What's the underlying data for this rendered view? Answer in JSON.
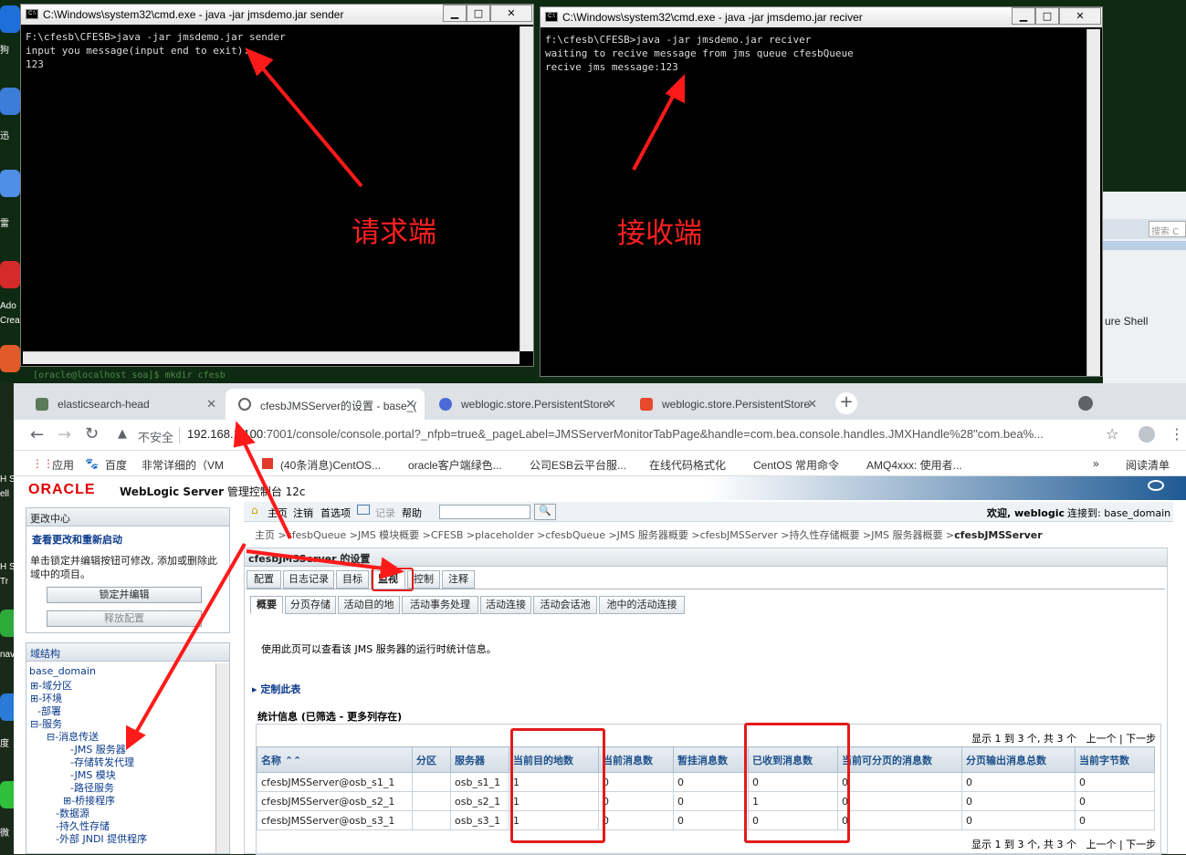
{
  "desktop": {
    "labels": [
      "狗",
      "迅",
      "雷",
      "Ado",
      "Crea",
      "H S",
      "ell",
      "H S",
      "Tr",
      "nav",
      "度",
      "微"
    ],
    "right_label": "ure Shell",
    "search_placeholder": "搜索 C",
    "faded_cmd": "[oracle@localhost soa]$ mkdir cfesb"
  },
  "sender": {
    "title": "C:\\Windows\\system32\\cmd.exe - java  -jar jmsdemo.jar sender",
    "lines": [
      "F:\\cfesb\\CFESB>java -jar jmsdemo.jar sender",
      "input you message(input end to exit):",
      "123"
    ],
    "annotation": "请求端"
  },
  "receiver": {
    "title": "C:\\Windows\\system32\\cmd.exe - java  -jar jmsdemo.jar reciver",
    "lines": [
      "f:\\cfesb\\CFESB>java -jar jmsdemo.jar reciver",
      "waiting to recive message from jms queue cfesbQueue",
      "recive jms message:123"
    ],
    "annotation": "接收端"
  },
  "window_buttons": {
    "min": "▁",
    "max": "□",
    "close": "✕"
  },
  "browser": {
    "tabs": [
      {
        "label": "elasticsearch-head",
        "color": "#5a7a5a"
      },
      {
        "label": "cfesbJMSServer的设置 - base_(",
        "color": "#888888"
      },
      {
        "label": "weblogic.store.PersistentStore",
        "color": "#4a6ad8"
      },
      {
        "label": "weblogic.store.PersistentStore",
        "color": "#e8482b"
      }
    ],
    "close": "✕",
    "new_tab": "+",
    "insecure": "不安全",
    "url_host": "192.168.1.100",
    "url_rest": ":7001/console/console.portal?_nfpb=true&_pageLabel=JMSServerMonitorTabPage&handle=com.bea.console.handles.JMXHandle%28\"com.bea%...",
    "bookmarks": [
      "应用",
      "百度",
      "非常详细的（VM",
      "(40条消息)CentOS...",
      "oracle客户端绿色...",
      "公司ESB云平台服...",
      "在线代码格式化",
      "CentOS 常用命令",
      "AMQ4xxx: 使用者...",
      "阅读清单"
    ],
    "bookmark_more": "»"
  },
  "weblogic": {
    "brand": "ORACLE",
    "product": "WebLogic Server",
    "product_suffix": "管理控制台 12c",
    "toolbar": [
      "主页",
      "注销",
      "首选项",
      "记录",
      "帮助"
    ],
    "welcome": "欢迎, weblogic",
    "connected": "连接到: base_domain",
    "breadcrumb": "主页 >cfesbQueue >JMS 模块概要 >CFESB >placeholder >cfesbQueue >JMS 服务器概要 >cfesbJMSServer >持久性存储概要 >JMS 服务器概要 >",
    "breadcrumb_last": "cfesbJMSServer",
    "change_center": {
      "title": "更改中心",
      "link": "查看更改和重新启动",
      "desc": "单击锁定并编辑按钮可修改, 添加或删除此域中的项目。",
      "lock_button": "锁定并编辑",
      "release_button": "释放配置"
    },
    "domain_structure": {
      "title": "域结构",
      "items": [
        "base_domain",
        "⊞-域分区",
        "⊞-环境",
        "-部署",
        "⊟-服务",
        "⊟-消息传送",
        "-JMS 服务器",
        "-存储转发代理",
        "-JMS 模块",
        "-路径服务",
        "⊞-桥接程序",
        "-数据源",
        "-持久性存储",
        "-外部 JNDI 提供程序"
      ]
    },
    "settings_title": "cfesbJMSServer 的设置",
    "main_tabs": [
      "配置",
      "日志记录",
      "目标",
      "监视",
      "控制",
      "注释"
    ],
    "sub_tabs": [
      "概要",
      "分页存储",
      "活动目的地",
      "活动事务处理",
      "活动连接",
      "活动会话池",
      "池中的活动连接"
    ],
    "intro": "使用此页可以查看该 JMS 服务器的运行时统计信息。",
    "customize": "定制此表",
    "stats_title": "统计信息 (已筛选 - 更多列存在)",
    "pager": "显示 1 到 3 个, 共 3 个",
    "prev": "上一个",
    "next": "下一步",
    "columns": [
      "名称 ⌃⌃",
      "分区",
      "服务器",
      "当前目的地数",
      "当前消息数",
      "暂挂消息数",
      "已收到消息数",
      "当前可分页的消息数",
      "分页输出消息总数",
      "当前字节数"
    ],
    "rows": [
      [
        "cfesbJMSServer@osb_s1_1",
        "",
        "osb_s1_1",
        "1",
        "0",
        "0",
        "0",
        "0",
        "0",
        "0"
      ],
      [
        "cfesbJMSServer@osb_s2_1",
        "",
        "osb_s2_1",
        "1",
        "0",
        "0",
        "1",
        "0",
        "0",
        "0"
      ],
      [
        "cfesbJMSServer@osb_s3_1",
        "",
        "osb_s3_1",
        "1",
        "0",
        "0",
        "0",
        "0",
        "0",
        "0"
      ]
    ]
  },
  "colors": {
    "annotation_red": "#ff2020",
    "oracle_red": "#e00000",
    "link_blue": "#0b3b8c"
  }
}
